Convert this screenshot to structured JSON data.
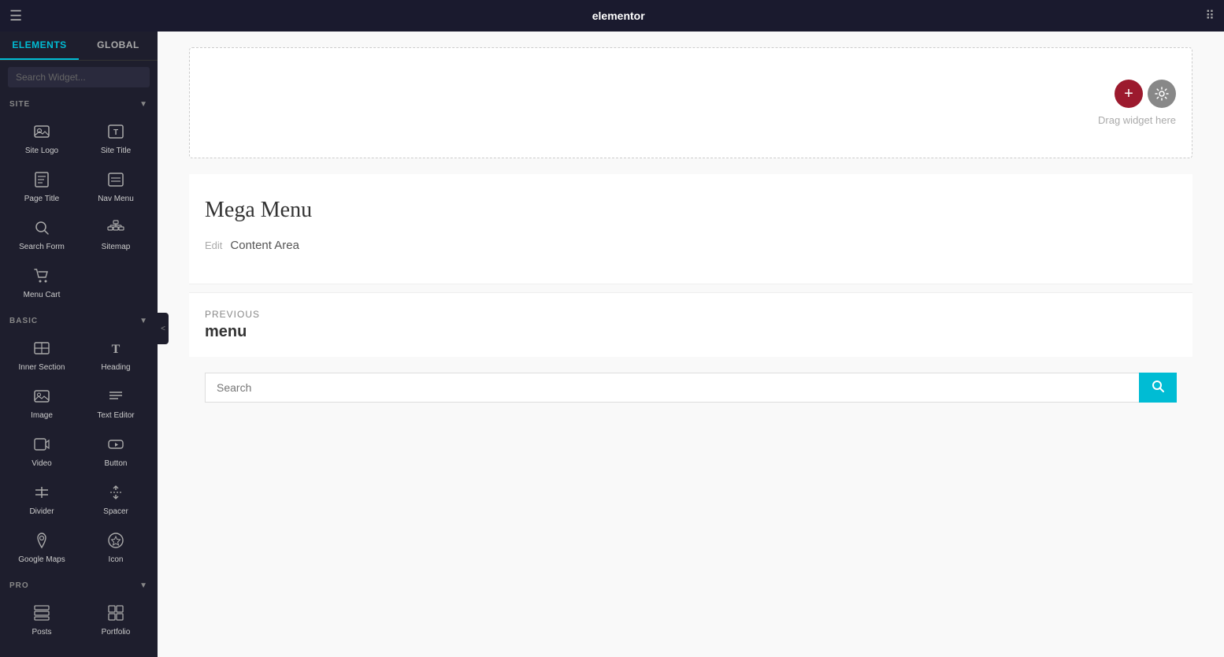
{
  "topbar": {
    "logo": "elementor",
    "hamburger": "☰",
    "grid_icon": "⠿"
  },
  "sidebar": {
    "tabs": [
      {
        "label": "ELEMENTS",
        "active": true
      },
      {
        "label": "GLOBAL",
        "active": false
      }
    ],
    "search_placeholder": "Search Widget...",
    "sections": {
      "site": {
        "label": "SITE",
        "widgets": [
          {
            "icon": "🖼",
            "label": "Site Logo"
          },
          {
            "icon": "T",
            "label": "Site Title"
          },
          {
            "icon": "📄",
            "label": "Page Title"
          },
          {
            "icon": "☰",
            "label": "Nav Menu"
          },
          {
            "icon": "🔍",
            "label": "Search Form"
          },
          {
            "icon": "🗺",
            "label": "Sitemap"
          },
          {
            "icon": "🛒",
            "label": "Menu Cart"
          }
        ]
      },
      "basic": {
        "label": "BASIC",
        "widgets": [
          {
            "icon": "▦",
            "label": "Inner Section"
          },
          {
            "icon": "T",
            "label": "Heading"
          },
          {
            "icon": "🖼",
            "label": "Image"
          },
          {
            "icon": "≡",
            "label": "Text Editor"
          },
          {
            "icon": "▶",
            "label": "Video"
          },
          {
            "icon": "⬜",
            "label": "Button"
          },
          {
            "icon": "—",
            "label": "Divider"
          },
          {
            "icon": "↕",
            "label": "Spacer"
          },
          {
            "icon": "📍",
            "label": "Google Maps"
          },
          {
            "icon": "★",
            "label": "Icon"
          }
        ]
      },
      "pro": {
        "label": "PRO",
        "widgets": [
          {
            "icon": "▤",
            "label": "Posts"
          },
          {
            "icon": "▦",
            "label": "Portfolio"
          }
        ]
      }
    }
  },
  "canvas": {
    "drag_zone": {
      "add_button": "+",
      "settings_button": "⚙",
      "drag_label": "Drag widget here"
    },
    "mega_menu": {
      "title": "Mega Menu",
      "edit_label": "Edit",
      "content_area_label": "Content Area"
    },
    "navigation": {
      "nav_label": "PREVIOUS",
      "nav_title": "menu"
    },
    "search": {
      "placeholder": "Search",
      "button_icon": "🔍"
    }
  },
  "collapse": {
    "icon": "<"
  }
}
